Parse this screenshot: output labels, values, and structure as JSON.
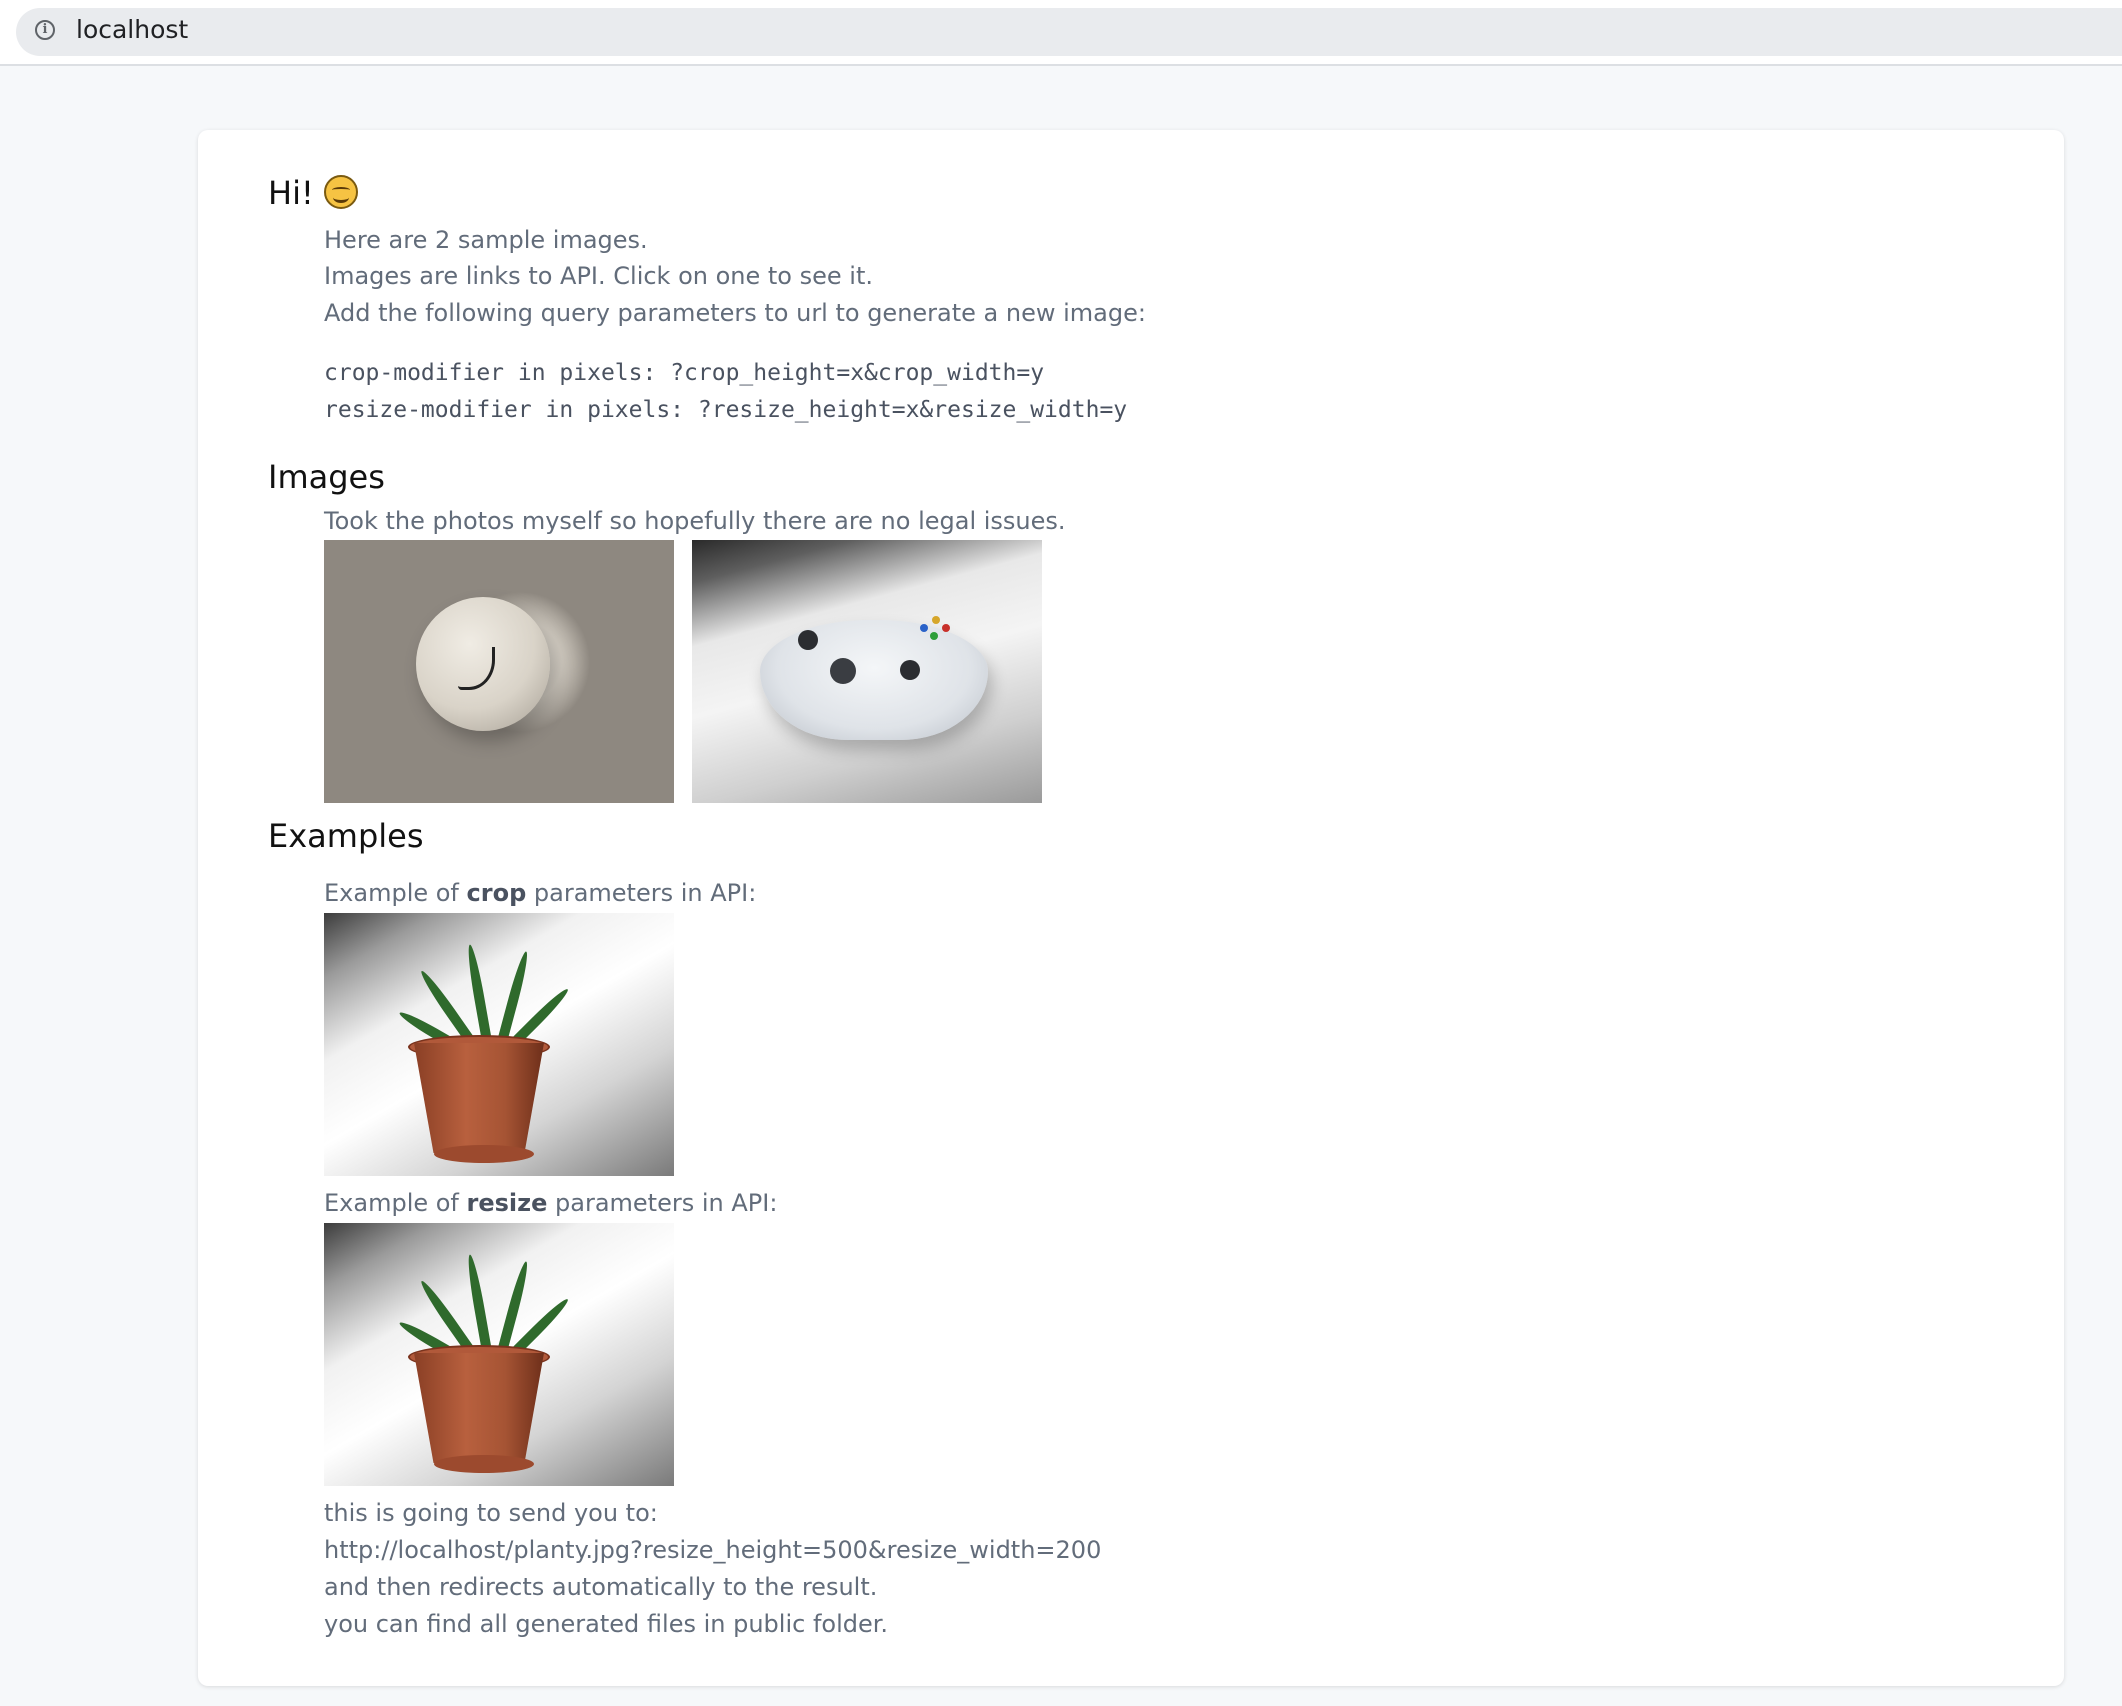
{
  "browser": {
    "url": "localhost"
  },
  "intro": {
    "heading": "Hi!",
    "lines": [
      "Here are 2 sample images.",
      "Images are links to API. Click on one to see it.",
      "Add the following query parameters to url to generate a new image:"
    ],
    "code_lines": [
      "crop-modifier in pixels: ?crop_height=x&crop_width=y",
      "resize-modifier in pixels: ?resize_height=x&resize_width=y"
    ]
  },
  "images_section": {
    "heading": "Images",
    "note": "Took the photos myself so hopefully there are no legal issues."
  },
  "examples_section": {
    "heading": "Examples",
    "crop_prefix": "Example of ",
    "crop_bold": "crop",
    "crop_suffix": " parameters in API:",
    "resize_prefix": "Example of ",
    "resize_bold": "resize",
    "resize_suffix": " parameters in API:",
    "footer_lines": [
      "this is going to send you to:",
      "http://localhost/planty.jpg?resize_height=500&resize_width=200",
      "and then redirects automatically to the result.",
      "you can find all generated files in public folder."
    ]
  }
}
